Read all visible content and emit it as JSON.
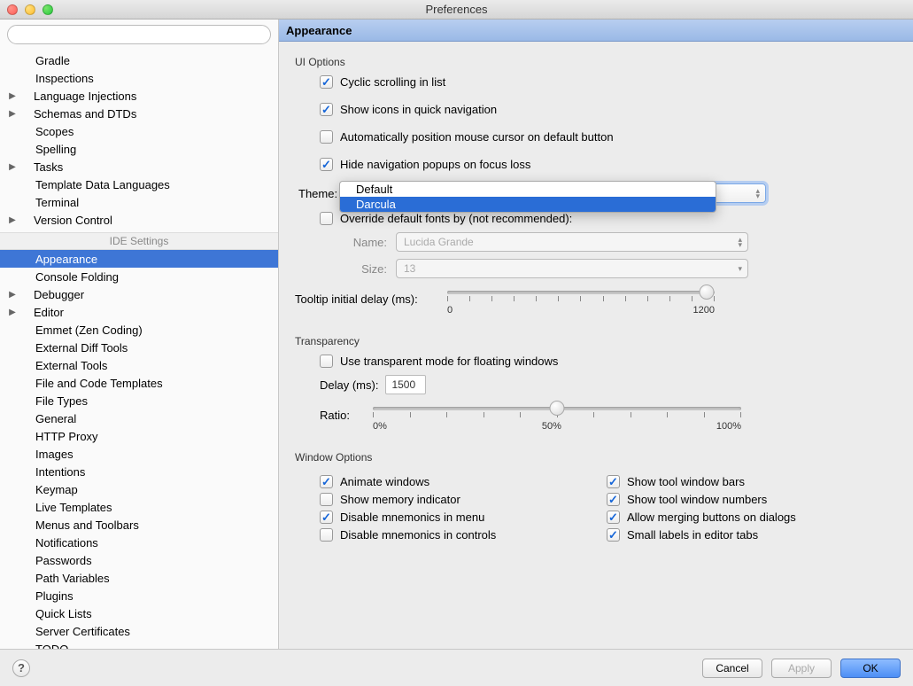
{
  "window": {
    "title": "Preferences"
  },
  "search": {
    "placeholder": ""
  },
  "sidebar": {
    "project": [
      {
        "label": "Gradle",
        "expandable": false,
        "indent": 2
      },
      {
        "label": "Inspections",
        "expandable": false,
        "indent": 2
      },
      {
        "label": "Language Injections",
        "expandable": true,
        "indent": 1
      },
      {
        "label": "Schemas and DTDs",
        "expandable": true,
        "indent": 1
      },
      {
        "label": "Scopes",
        "expandable": false,
        "indent": 2
      },
      {
        "label": "Spelling",
        "expandable": false,
        "indent": 2
      },
      {
        "label": "Tasks",
        "expandable": true,
        "indent": 1
      },
      {
        "label": "Template Data Languages",
        "expandable": false,
        "indent": 2
      },
      {
        "label": "Terminal",
        "expandable": false,
        "indent": 2
      },
      {
        "label": "Version Control",
        "expandable": true,
        "indent": 1
      }
    ],
    "ide_header": "IDE Settings",
    "ide": [
      {
        "label": "Appearance",
        "selected": true,
        "indent": 2
      },
      {
        "label": "Console Folding",
        "indent": 2
      },
      {
        "label": "Debugger",
        "expandable": true,
        "indent": 1
      },
      {
        "label": "Editor",
        "expandable": true,
        "indent": 1
      },
      {
        "label": "Emmet (Zen Coding)",
        "indent": 2
      },
      {
        "label": "External Diff Tools",
        "indent": 2
      },
      {
        "label": "External Tools",
        "indent": 2
      },
      {
        "label": "File and Code Templates",
        "indent": 2
      },
      {
        "label": "File Types",
        "indent": 2
      },
      {
        "label": "General",
        "indent": 2
      },
      {
        "label": "HTTP Proxy",
        "indent": 2
      },
      {
        "label": "Images",
        "indent": 2
      },
      {
        "label": "Intentions",
        "indent": 2
      },
      {
        "label": "Keymap",
        "indent": 2
      },
      {
        "label": "Live Templates",
        "indent": 2
      },
      {
        "label": "Menus and Toolbars",
        "indent": 2
      },
      {
        "label": "Notifications",
        "indent": 2
      },
      {
        "label": "Passwords",
        "indent": 2
      },
      {
        "label": "Path Variables",
        "indent": 2
      },
      {
        "label": "Plugins",
        "indent": 2
      },
      {
        "label": "Quick Lists",
        "indent": 2
      },
      {
        "label": "Server Certificates",
        "indent": 2
      },
      {
        "label": "TODO",
        "indent": 2
      }
    ]
  },
  "panel": {
    "title": "Appearance",
    "ui_options": {
      "title": "UI Options",
      "cyclic_scrolling": {
        "label": "Cyclic scrolling in list",
        "checked": true
      },
      "show_icons": {
        "label": "Show icons in quick navigation",
        "checked": true
      },
      "auto_position": {
        "label": "Automatically position mouse cursor on default button",
        "checked": false
      },
      "hide_popups": {
        "label": "Hide navigation popups on focus loss",
        "checked": true
      },
      "theme_label": "Theme:",
      "theme_options": [
        "Default",
        "Darcula"
      ],
      "theme_highlight_index": 1,
      "override_fonts": {
        "label": "Override default fonts by (not recommended):",
        "checked": false
      },
      "name_label": "Name:",
      "name_value": "Lucida Grande",
      "size_label": "Size:",
      "size_value": "13",
      "tooltip_label": "Tooltip initial delay (ms):",
      "tooltip_min": "0",
      "tooltip_max": "1200",
      "tooltip_pos_percent": 97
    },
    "transparency": {
      "title": "Transparency",
      "use_transparent": {
        "label": "Use transparent mode for floating windows",
        "checked": false
      },
      "delay_label": "Delay (ms):",
      "delay_value": "1500",
      "ratio_label": "Ratio:",
      "ratio_min": "0%",
      "ratio_mid": "50%",
      "ratio_max": "100%",
      "ratio_pos_percent": 50
    },
    "window_options": {
      "title": "Window Options",
      "left": [
        {
          "key": "animate",
          "label": "Animate windows",
          "checked": true
        },
        {
          "key": "memory",
          "label": "Show memory indicator",
          "checked": false
        },
        {
          "key": "mnemonics_menu",
          "label": "Disable mnemonics in menu",
          "checked": true
        },
        {
          "key": "mnemonics_controls",
          "label": "Disable mnemonics in controls",
          "checked": false
        }
      ],
      "right": [
        {
          "key": "tool_bars",
          "label": "Show tool window bars",
          "checked": true
        },
        {
          "key": "tool_numbers",
          "label": "Show tool window numbers",
          "checked": true
        },
        {
          "key": "merge_dialogs",
          "label": "Allow merging buttons on dialogs",
          "checked": true
        },
        {
          "key": "small_labels",
          "label": "Small labels in editor tabs",
          "checked": true
        }
      ]
    }
  },
  "footer": {
    "help": "?",
    "cancel": "Cancel",
    "apply": "Apply",
    "ok": "OK"
  }
}
